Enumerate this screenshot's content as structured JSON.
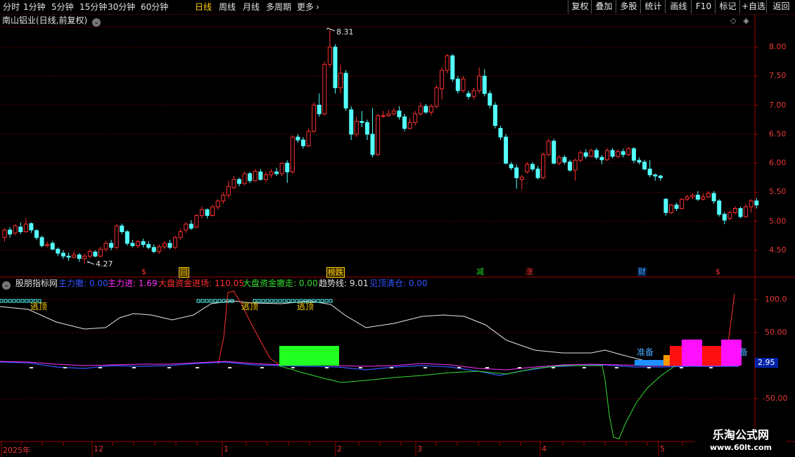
{
  "toolbar": {
    "periods": [
      "分时",
      "1分钟",
      "5分钟",
      "15分钟",
      "30分钟",
      "60分钟",
      "日线",
      "周线",
      "月线",
      "多周期",
      "更多"
    ],
    "active_period": "日线",
    "right_buttons": [
      "复权",
      "叠加",
      "多股",
      "统计",
      "画线",
      "F10",
      "标记",
      "+自选",
      "返回"
    ]
  },
  "stock": {
    "title": "南山铝业(日线,前复权)"
  },
  "price_axis": {
    "ticks": [
      "8.00",
      "7.50",
      "7.00",
      "6.50",
      "6.00",
      "5.50",
      "5.00",
      "4.50"
    ],
    "max_label": "8.31",
    "min_label": "4.27"
  },
  "signals": [
    {
      "text": "$",
      "color": "#ff3030"
    },
    {
      "text": "回",
      "color": "#ffd000"
    },
    {
      "text": "榜跌",
      "color": "#ffd000"
    },
    {
      "text": "减",
      "color": "#22dd22"
    },
    {
      "text": "涨",
      "color": "#ff3030"
    },
    {
      "text": "财",
      "color": "#4aa8ff"
    },
    {
      "text": "$",
      "color": "#ff3030"
    }
  ],
  "indicator": {
    "name": "股朋指标网",
    "items": [
      {
        "label": "主力撤: 0.00",
        "color": "#3355ff"
      },
      {
        "label": "主力进: 1.69",
        "color": "#ff33ff"
      },
      {
        "label": "大盘资金进场: 110.05",
        "color": "#ff3030"
      },
      {
        "label": "大盘资金撤走: 0.00",
        "color": "#33dd33"
      },
      {
        "label": "趋势线: 9.01",
        "color": "#e0e0e0"
      },
      {
        "label": "见顶清仓: 0.00",
        "color": "#3355ff"
      }
    ],
    "axis_ticks": [
      "100.0",
      "50.00",
      "-50.00"
    ],
    "current_value": "2.95",
    "labels": {
      "top1": "逃顶",
      "top2": "逃顶",
      "top3": "逃顶",
      "prepare": "准备",
      "cut": "备"
    }
  },
  "time_axis": {
    "labels": [
      "2025年",
      "12",
      "1",
      "2",
      "3",
      "4",
      "5"
    ]
  },
  "watermark": {
    "line1": "乐淘公式网",
    "line2": "www.60lt.com"
  },
  "colors": {
    "up": "#ff3030",
    "down": "#54ffff",
    "grid": "#8b0000",
    "axis_text": "#e53935"
  },
  "chart_data": {
    "type": "candlestick",
    "title": "南山铝业(日线,前复权)",
    "ylim": [
      4.2,
      8.4
    ],
    "period": "日线",
    "note_extremes": {
      "high": 8.31,
      "low": 4.27
    },
    "candles": [
      [
        4.72,
        4.85,
        4.65,
        4.88
      ],
      [
        4.85,
        4.78,
        4.72,
        4.9
      ],
      [
        4.8,
        4.92,
        4.76,
        4.95
      ],
      [
        4.9,
        4.82,
        4.78,
        4.98
      ],
      [
        4.82,
        4.95,
        4.8,
        5.05
      ],
      [
        4.96,
        4.85,
        4.8,
        4.98
      ],
      [
        4.84,
        4.72,
        4.68,
        4.86
      ],
      [
        4.72,
        4.58,
        4.55,
        4.75
      ],
      [
        4.58,
        4.6,
        4.55,
        4.65
      ],
      [
        4.62,
        4.52,
        4.5,
        4.66
      ],
      [
        4.52,
        4.45,
        4.4,
        4.55
      ],
      [
        4.45,
        4.4,
        4.35,
        4.5
      ],
      [
        4.4,
        4.38,
        4.32,
        4.46
      ],
      [
        4.38,
        4.42,
        4.36,
        4.48
      ],
      [
        4.42,
        4.36,
        4.3,
        4.45
      ],
      [
        4.36,
        4.4,
        4.27,
        4.44
      ],
      [
        4.4,
        4.48,
        4.36,
        4.52
      ],
      [
        4.47,
        4.4,
        4.38,
        4.5
      ],
      [
        4.4,
        4.52,
        4.38,
        4.56
      ],
      [
        4.52,
        4.62,
        4.48,
        4.66
      ],
      [
        4.62,
        4.55,
        4.5,
        4.68
      ],
      [
        4.55,
        4.92,
        4.52,
        4.95
      ],
      [
        4.92,
        4.82,
        4.78,
        4.96
      ],
      [
        4.82,
        4.62,
        4.58,
        4.85
      ],
      [
        4.62,
        4.58,
        4.55,
        4.68
      ],
      [
        4.58,
        4.65,
        4.54,
        4.68
      ],
      [
        4.65,
        4.6,
        4.55,
        4.7
      ],
      [
        4.6,
        4.55,
        4.52,
        4.66
      ],
      [
        4.55,
        4.48,
        4.45,
        4.6
      ],
      [
        4.48,
        4.56,
        4.44,
        4.6
      ],
      [
        4.56,
        4.62,
        4.52,
        4.66
      ],
      [
        4.62,
        4.55,
        4.52,
        4.68
      ],
      [
        4.55,
        4.72,
        4.52,
        4.75
      ],
      [
        4.72,
        4.82,
        4.68,
        4.88
      ],
      [
        4.85,
        4.95,
        4.8,
        4.98
      ],
      [
        4.95,
        4.88,
        4.85,
        5.02
      ],
      [
        4.9,
        5.1,
        4.88,
        5.12
      ],
      [
        5.1,
        5.2,
        5.05,
        5.25
      ],
      [
        5.2,
        5.1,
        5.05,
        5.22
      ],
      [
        5.1,
        5.25,
        5.08,
        5.28
      ],
      [
        5.25,
        5.35,
        5.2,
        5.38
      ],
      [
        5.35,
        5.45,
        5.3,
        5.5
      ],
      [
        5.45,
        5.6,
        5.4,
        5.7
      ],
      [
        5.58,
        5.72,
        5.55,
        5.78
      ],
      [
        5.72,
        5.65,
        5.6,
        5.75
      ],
      [
        5.65,
        5.82,
        5.62,
        5.86
      ],
      [
        5.82,
        5.7,
        5.66,
        5.85
      ],
      [
        5.7,
        5.86,
        5.68,
        5.9
      ],
      [
        5.85,
        5.72,
        5.7,
        5.9
      ],
      [
        5.72,
        5.8,
        5.68,
        5.85
      ],
      [
        5.8,
        5.85,
        5.75,
        5.9
      ],
      [
        5.85,
        5.82,
        5.78,
        5.92
      ],
      [
        5.82,
        6.0,
        5.78,
        6.02
      ],
      [
        6.0,
        5.85,
        5.66,
        6.05
      ],
      [
        5.85,
        6.45,
        5.82,
        6.48
      ],
      [
        6.45,
        6.4,
        6.35,
        6.5
      ],
      [
        6.4,
        6.3,
        6.25,
        6.45
      ],
      [
        6.3,
        6.55,
        6.28,
        6.6
      ],
      [
        6.55,
        7.0,
        6.52,
        7.05
      ],
      [
        7.0,
        6.85,
        6.8,
        7.2
      ],
      [
        6.85,
        7.7,
        6.82,
        7.75
      ],
      [
        7.7,
        8.0,
        7.65,
        8.31
      ],
      [
        8.0,
        7.3,
        7.2,
        8.05
      ],
      [
        7.3,
        7.55,
        7.2,
        7.7
      ],
      [
        7.55,
        6.95,
        6.9,
        7.6
      ],
      [
        6.92,
        6.5,
        6.4,
        6.98
      ],
      [
        6.5,
        6.72,
        6.45,
        6.8
      ],
      [
        6.72,
        6.7,
        6.62,
        6.9
      ],
      [
        6.7,
        6.5,
        6.4,
        6.75
      ],
      [
        6.5,
        6.15,
        6.1,
        6.95
      ],
      [
        6.15,
        6.82,
        6.12,
        6.85
      ],
      [
        6.82,
        6.82,
        6.78,
        6.9
      ],
      [
        6.82,
        6.85,
        6.8,
        6.92
      ],
      [
        6.85,
        6.9,
        6.82,
        6.95
      ],
      [
        6.9,
        6.8,
        6.75,
        6.98
      ],
      [
        6.8,
        6.6,
        6.55,
        6.85
      ],
      [
        6.6,
        6.7,
        6.58,
        6.78
      ],
      [
        6.7,
        6.85,
        6.65,
        6.9
      ],
      [
        6.85,
        6.98,
        6.82,
        7.05
      ],
      [
        6.98,
        6.88,
        6.85,
        7.02
      ],
      [
        6.88,
        6.98,
        6.82,
        7.02
      ],
      [
        6.98,
        7.3,
        6.95,
        7.35
      ],
      [
        7.28,
        7.6,
        7.1,
        7.65
      ],
      [
        7.6,
        7.85,
        7.55,
        7.88
      ],
      [
        7.85,
        7.45,
        7.4,
        7.88
      ],
      [
        7.45,
        7.25,
        7.2,
        7.5
      ],
      [
        7.25,
        7.45,
        7.22,
        7.5
      ],
      [
        7.2,
        7.15,
        7.1,
        7.25
      ],
      [
        7.15,
        7.25,
        7.1,
        7.3
      ],
      [
        7.25,
        7.5,
        7.2,
        7.65
      ],
      [
        7.5,
        7.2,
        7.15,
        7.62
      ],
      [
        7.2,
        7.0,
        6.95,
        7.25
      ],
      [
        7.0,
        6.65,
        6.6,
        7.05
      ],
      [
        6.6,
        6.45,
        6.4,
        6.65
      ],
      [
        6.45,
        6.0,
        5.98,
        6.5
      ],
      [
        5.98,
        5.92,
        5.88,
        6.02
      ],
      [
        5.92,
        5.75,
        5.56,
        5.98
      ],
      [
        5.72,
        5.76,
        5.55,
        5.8
      ],
      [
        5.85,
        5.98,
        5.82,
        6.02
      ],
      [
        5.98,
        5.9,
        5.86,
        6.02
      ],
      [
        5.9,
        5.75,
        5.72,
        5.95
      ],
      [
        5.75,
        6.15,
        5.72,
        6.18
      ],
      [
        6.15,
        6.38,
        6.12,
        6.42
      ],
      [
        6.38,
        6.0,
        5.98,
        6.42
      ],
      [
        6.0,
        6.1,
        5.96,
        6.14
      ],
      [
        6.1,
        6.02,
        5.98,
        6.14
      ],
      [
        6.02,
        5.88,
        5.85,
        6.06
      ],
      [
        5.88,
        6.05,
        5.7,
        6.08
      ],
      [
        6.05,
        6.18,
        6.02,
        6.22
      ],
      [
        6.18,
        6.12,
        6.08,
        6.24
      ],
      [
        6.12,
        6.22,
        6.1,
        6.25
      ],
      [
        6.22,
        6.1,
        6.06,
        6.26
      ],
      [
        6.1,
        6.06,
        5.98,
        6.14
      ],
      [
        6.06,
        6.22,
        6.04,
        6.26
      ],
      [
        6.22,
        6.12,
        6.08,
        6.26
      ],
      [
        6.12,
        6.2,
        6.08,
        6.24
      ],
      [
        6.2,
        6.15,
        6.1,
        6.25
      ],
      [
        6.15,
        6.25,
        6.12,
        6.28
      ],
      [
        6.25,
        6.05,
        6.0,
        6.28
      ],
      [
        6.05,
        6.02,
        5.98,
        6.1
      ],
      [
        6.02,
        5.9,
        5.88,
        6.06
      ],
      [
        5.9,
        5.8,
        5.76,
        6.05
      ],
      [
        5.8,
        5.78,
        5.7,
        5.82
      ],
      [
        5.78,
        5.75,
        5.7,
        5.8
      ],
      [
        5.38,
        5.15,
        5.1,
        5.4
      ],
      [
        5.15,
        5.28,
        5.12,
        5.3
      ],
      [
        5.28,
        5.22,
        5.18,
        5.32
      ],
      [
        5.22,
        5.38,
        5.2,
        5.4
      ],
      [
        5.38,
        5.42,
        5.35,
        5.46
      ],
      [
        5.42,
        5.45,
        5.38,
        5.48
      ],
      [
        5.45,
        5.38,
        5.35,
        5.52
      ],
      [
        5.38,
        5.42,
        5.36,
        5.48
      ],
      [
        5.42,
        5.48,
        5.4,
        5.52
      ],
      [
        5.48,
        5.35,
        5.3,
        5.52
      ],
      [
        5.35,
        5.12,
        5.08,
        5.38
      ],
      [
        5.12,
        5.02,
        4.95,
        5.16
      ],
      [
        5.05,
        5.15,
        5.02,
        5.18
      ],
      [
        5.15,
        5.22,
        5.12,
        5.26
      ],
      [
        5.22,
        5.08,
        5.05,
        5.25
      ],
      [
        5.08,
        5.25,
        5.06,
        5.3
      ],
      [
        5.25,
        5.35,
        5.15,
        5.38
      ],
      [
        5.35,
        5.28,
        5.22,
        5.4
      ]
    ],
    "indicator_series": {
      "趋势线_visible_labels": [
        "逃顶",
        "逃顶",
        "逃顶"
      ],
      "axis_ticks": [
        100,
        50,
        -50
      ]
    }
  }
}
